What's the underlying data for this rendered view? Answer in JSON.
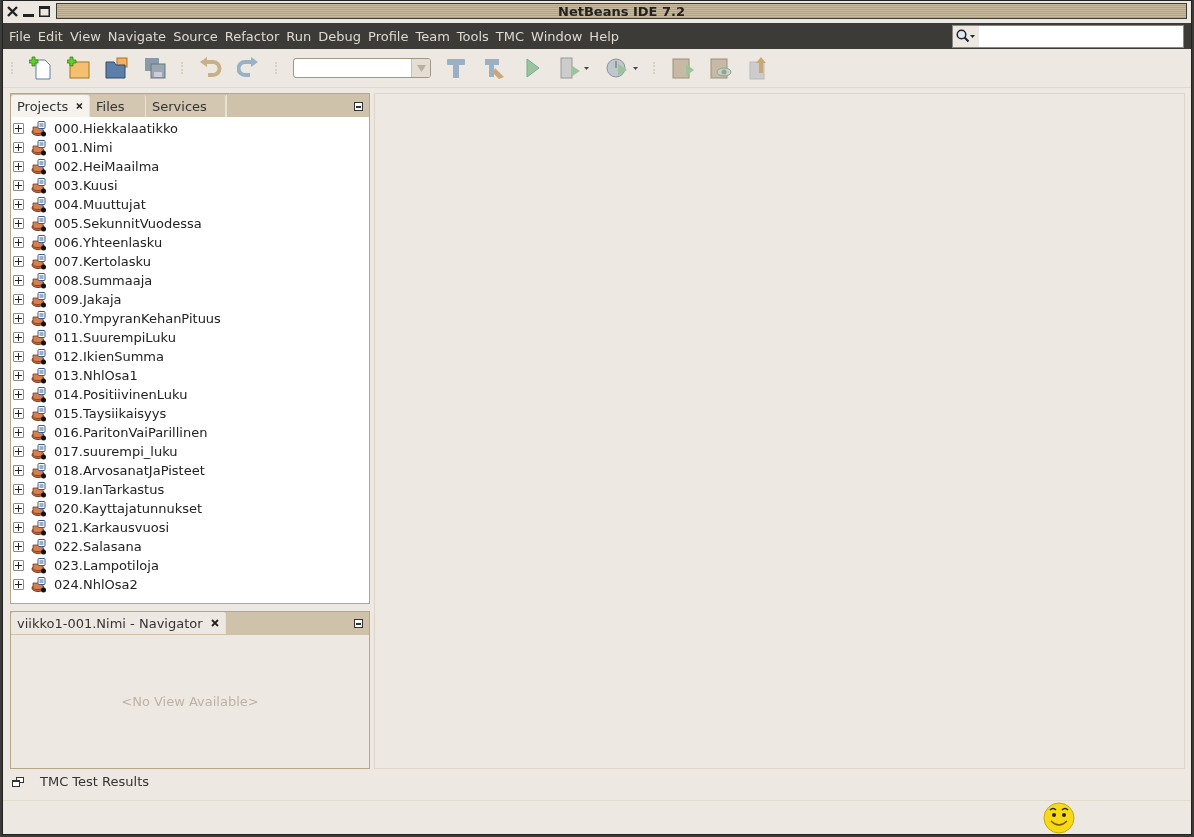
{
  "window": {
    "title": "NetBeans IDE 7.2"
  },
  "menu": [
    "File",
    "Edit",
    "View",
    "Navigate",
    "Source",
    "Refactor",
    "Run",
    "Debug",
    "Profile",
    "Team",
    "Tools",
    "TMC",
    "Window",
    "Help"
  ],
  "projects_panel": {
    "tabs": [
      {
        "label": "Projects",
        "selected": true,
        "closable": true
      },
      {
        "label": "Files",
        "selected": false,
        "closable": false
      },
      {
        "label": "Services",
        "selected": false,
        "closable": false
      }
    ],
    "items": [
      {
        "label": "000.Hiekkalaatikko",
        "expanded": false
      },
      {
        "label": "001.Nimi",
        "expanded": false
      },
      {
        "label": "002.HeiMaailma",
        "expanded": false
      },
      {
        "label": "003.Kuusi",
        "expanded": false
      },
      {
        "label": "004.Muuttujat",
        "expanded": false
      },
      {
        "label": "005.SekunnitVuodessa",
        "expanded": false
      },
      {
        "label": "006.Yhteenlasku",
        "expanded": false
      },
      {
        "label": "007.Kertolasku",
        "expanded": false
      },
      {
        "label": "008.Summaaja",
        "expanded": false
      },
      {
        "label": "009.Jakaja",
        "expanded": false
      },
      {
        "label": "010.YmpyranKehanPituus",
        "expanded": false
      },
      {
        "label": "011.SuurempiLuku",
        "expanded": false
      },
      {
        "label": "012.IkienSumma",
        "expanded": false
      },
      {
        "label": "013.NhlOsa1",
        "expanded": false
      },
      {
        "label": "014.PositiivinenLuku",
        "expanded": false
      },
      {
        "label": "015.Taysiikaisyys",
        "expanded": false
      },
      {
        "label": "016.ParitonVaiParillinen",
        "expanded": false
      },
      {
        "label": "017.suurempi_luku",
        "expanded": false
      },
      {
        "label": "018.ArvosanatJaPisteet",
        "expanded": false
      },
      {
        "label": "019.IanTarkastus",
        "expanded": false
      },
      {
        "label": "020.Kayttajatunnukset",
        "expanded": false
      },
      {
        "label": "021.Karkausvuosi",
        "expanded": false
      },
      {
        "label": "022.Salasana",
        "expanded": false
      },
      {
        "label": "023.Lampotiloja",
        "expanded": false
      },
      {
        "label": "024.NhlOsa2",
        "expanded": false
      }
    ]
  },
  "navigator": {
    "tab": {
      "label": "viikko1-001.Nimi - Navigator",
      "selected": true,
      "closable": true
    },
    "message": "<No View Available>"
  },
  "minimized_windows": [
    {
      "label": "TMC Test Results"
    }
  ]
}
